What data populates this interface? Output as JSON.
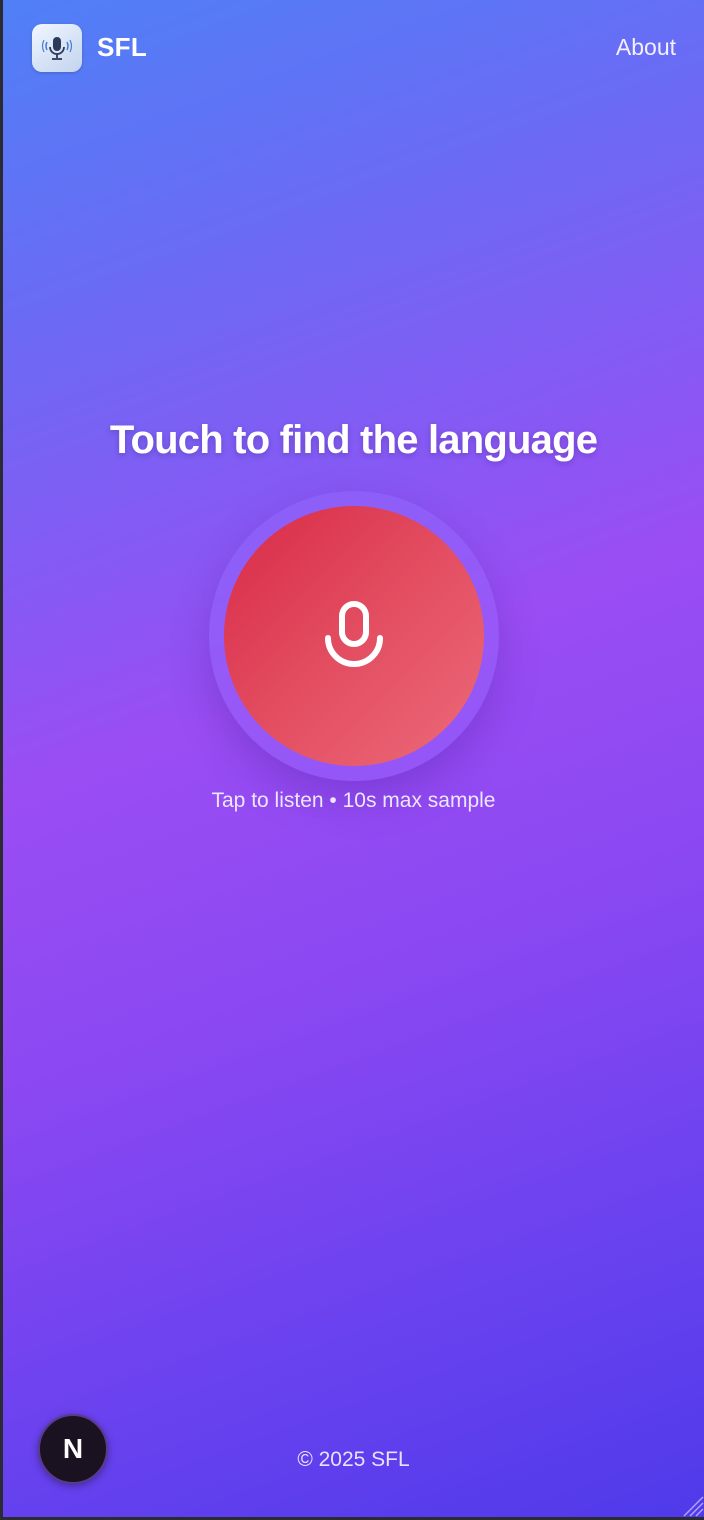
{
  "header": {
    "brand": "SFL",
    "logo_icon": "microphone-icon",
    "about_label": "About"
  },
  "main": {
    "headline": "Touch to find the language",
    "mic_icon": "microphone-icon",
    "hint": "Tap to listen • 10s max sample"
  },
  "footer": {
    "copyright": "© 2025 SFL"
  },
  "dev_badge": {
    "letter": "N"
  },
  "colors": {
    "gradient_start": "#4f80f6",
    "gradient_mid": "#9a4df3",
    "gradient_end": "#4f3aea",
    "mic_button_start": "#d82a48",
    "mic_button_end": "#ec6a7a"
  }
}
